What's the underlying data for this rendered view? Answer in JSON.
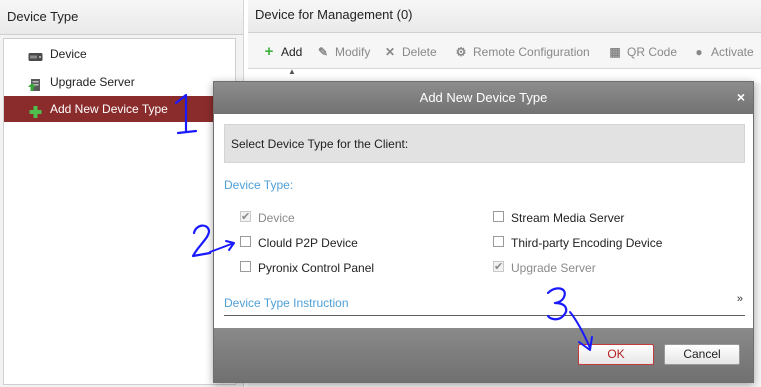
{
  "left_panel": {
    "title": "Device Type",
    "items": [
      {
        "label": "Device",
        "icon": "device-icon",
        "selected": false
      },
      {
        "label": "Upgrade Server",
        "icon": "upgrade-server-icon",
        "selected": false
      },
      {
        "label": "Add New Device Type",
        "icon": "plus-icon",
        "selected": true
      }
    ]
  },
  "right_panel": {
    "title": "Device for Management (0)",
    "toolbar": {
      "add": "Add",
      "modify": "Modify",
      "delete": "Delete",
      "remote_config": "Remote Configuration",
      "qr_code": "QR Code",
      "activate": "Activate"
    }
  },
  "dialog": {
    "title": "Add New Device Type",
    "instruction": "Select Device Type for the Client:",
    "section_label": "Device Type:",
    "options": [
      {
        "label": "Device",
        "checked": true,
        "disabled": true
      },
      {
        "label": "Stream Media Server",
        "checked": false,
        "disabled": false
      },
      {
        "label": "Clould P2P Device",
        "checked": false,
        "disabled": false
      },
      {
        "label": "Third-party Encoding Device",
        "checked": false,
        "disabled": false
      },
      {
        "label": "Pyronix Control Panel",
        "checked": false,
        "disabled": false
      },
      {
        "label": "Upgrade Server",
        "checked": true,
        "disabled": true
      }
    ],
    "instruction_link": "Device Type Instruction",
    "ok_label": "OK",
    "cancel_label": "Cancel"
  },
  "annotations": [
    "1",
    "2",
    "3"
  ],
  "colors": {
    "selected_row": "#8b2c2c",
    "accent_blue": "#4f9fd6",
    "ok_border": "#c23a3a",
    "annotation_ink": "#1a1aff"
  }
}
